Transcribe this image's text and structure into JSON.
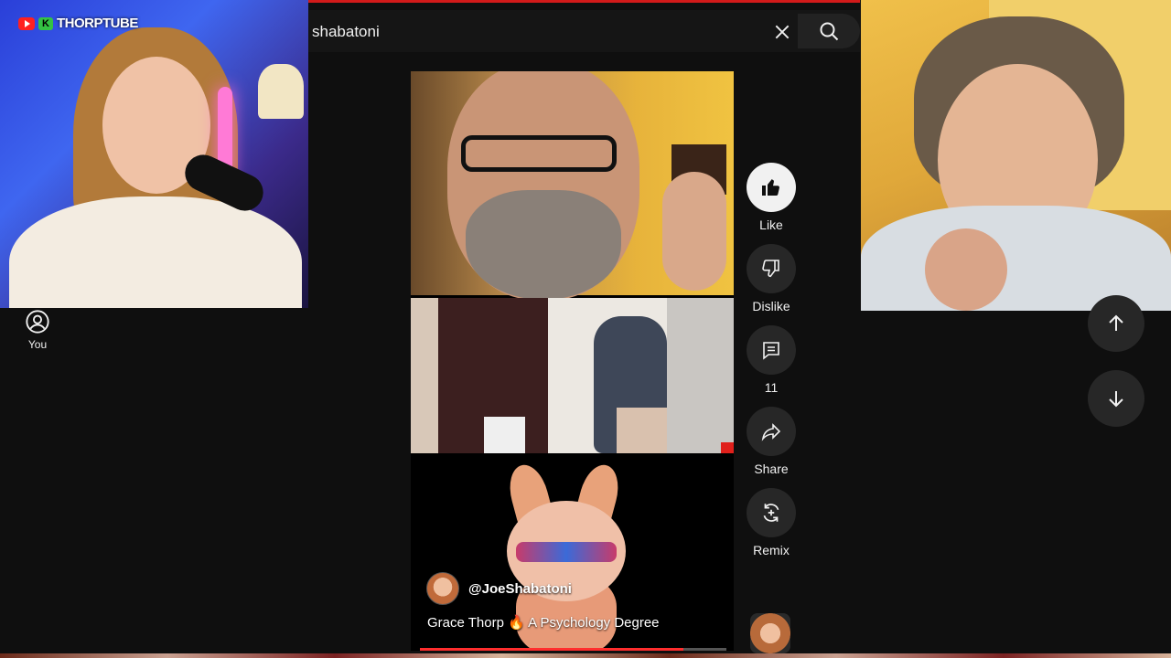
{
  "overlay": {
    "channel_name": "THORPTUBE",
    "k_badge": "K"
  },
  "sidebar": {
    "you_label": "You"
  },
  "search": {
    "query": "shabatoni"
  },
  "short": {
    "author_handle": "@JoeShabatoni",
    "title": "Grace Thorp 🔥 A Psychology Degree",
    "progress": 0.86
  },
  "actions": {
    "like_label": "Like",
    "dislike_label": "Dislike",
    "comments_count": "11",
    "share_label": "Share",
    "remix_label": "Remix"
  },
  "icons": {
    "like": "thumb-up-icon",
    "dislike": "thumb-down-icon",
    "comments": "comment-icon",
    "share": "share-icon",
    "remix": "remix-icon",
    "nav_up": "arrow-up-icon",
    "nav_down": "arrow-down-icon",
    "search": "search-icon",
    "clear": "close-icon",
    "account": "account-circle-icon"
  },
  "colors": {
    "background": "#0f0f0f",
    "button_bg": "#272727",
    "brand_red": "#ff0000"
  }
}
